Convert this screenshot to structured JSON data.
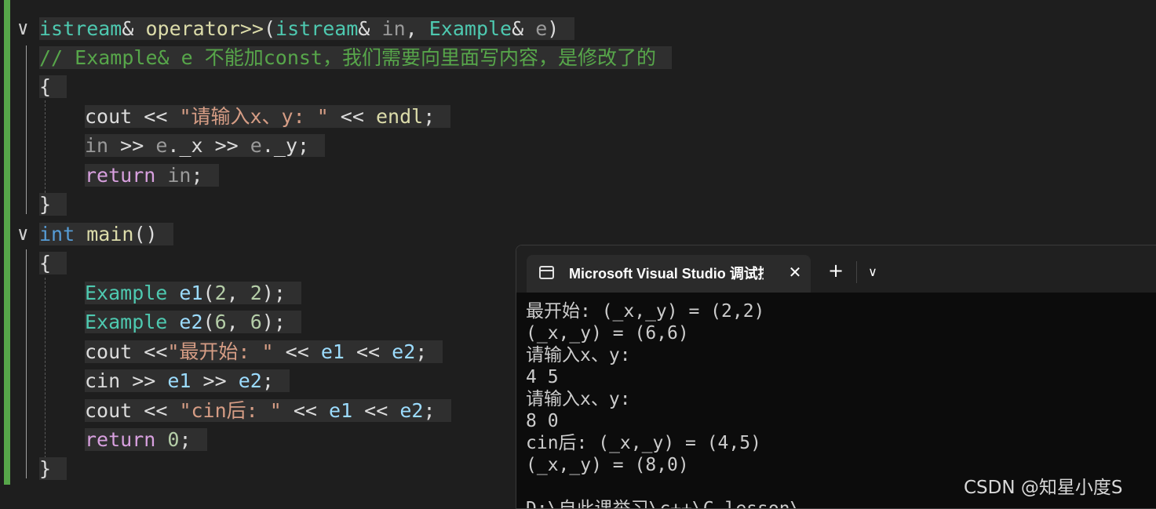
{
  "editor": {
    "lines": [
      {
        "id": "l1",
        "tokens": [
          {
            "t": "istream",
            "c": "c-type"
          },
          {
            "t": "& ",
            "c": "c-plain"
          },
          {
            "t": "operator>>",
            "c": "c-func"
          },
          {
            "t": "(",
            "c": "c-plain"
          },
          {
            "t": "istream",
            "c": "c-type"
          },
          {
            "t": "& ",
            "c": "c-plain"
          },
          {
            "t": "in",
            "c": "c-param"
          },
          {
            "t": ", ",
            "c": "c-plain"
          },
          {
            "t": "Example",
            "c": "c-type"
          },
          {
            "t": "& ",
            "c": "c-plain"
          },
          {
            "t": "e",
            "c": "c-param"
          },
          {
            "t": ")",
            "c": "c-plain"
          }
        ]
      },
      {
        "id": "l2",
        "tokens": [
          {
            "t": "// Example& e 不能加const，我们需要向里面写内容，是修改了的",
            "c": "c-comment"
          }
        ]
      },
      {
        "id": "l3",
        "tokens": [
          {
            "t": "{",
            "c": "c-plain"
          }
        ]
      },
      {
        "id": "l4",
        "tokens": [
          {
            "t": "cout",
            "c": "c-plain"
          },
          {
            "t": " << ",
            "c": "c-plain"
          },
          {
            "t": "\"请输入x、y: \"",
            "c": "c-str"
          },
          {
            "t": " << ",
            "c": "c-plain"
          },
          {
            "t": "endl",
            "c": "c-func"
          },
          {
            "t": ";",
            "c": "c-plain"
          }
        ]
      },
      {
        "id": "l5",
        "tokens": [
          {
            "t": "in",
            "c": "c-param"
          },
          {
            "t": " >> ",
            "c": "c-plain"
          },
          {
            "t": "e",
            "c": "c-param"
          },
          {
            "t": ".",
            "c": "c-plain"
          },
          {
            "t": "_x",
            "c": "c-field"
          },
          {
            "t": " >> ",
            "c": "c-plain"
          },
          {
            "t": "e",
            "c": "c-param"
          },
          {
            "t": ".",
            "c": "c-plain"
          },
          {
            "t": "_y",
            "c": "c-field"
          },
          {
            "t": ";",
            "c": "c-plain"
          }
        ]
      },
      {
        "id": "l6",
        "tokens": [
          {
            "t": "return",
            "c": "c-ctrl"
          },
          {
            "t": " ",
            "c": "c-plain"
          },
          {
            "t": "in",
            "c": "c-param"
          },
          {
            "t": ";",
            "c": "c-plain"
          }
        ]
      },
      {
        "id": "l7",
        "tokens": [
          {
            "t": "}",
            "c": "c-plain"
          }
        ]
      },
      {
        "id": "l8",
        "tokens": [
          {
            "t": "int",
            "c": "c-kw"
          },
          {
            "t": " ",
            "c": "c-plain"
          },
          {
            "t": "main",
            "c": "c-func"
          },
          {
            "t": "()",
            "c": "c-plain"
          }
        ]
      },
      {
        "id": "l9",
        "tokens": [
          {
            "t": "{",
            "c": "c-plain"
          }
        ]
      },
      {
        "id": "l10",
        "tokens": [
          {
            "t": "Example",
            "c": "c-type"
          },
          {
            "t": " ",
            "c": "c-plain"
          },
          {
            "t": "e1",
            "c": "c-var"
          },
          {
            "t": "(",
            "c": "c-plain"
          },
          {
            "t": "2",
            "c": "c-num"
          },
          {
            "t": ", ",
            "c": "c-plain"
          },
          {
            "t": "2",
            "c": "c-num"
          },
          {
            "t": ");",
            "c": "c-plain"
          }
        ]
      },
      {
        "id": "l11",
        "tokens": [
          {
            "t": "Example",
            "c": "c-type"
          },
          {
            "t": " ",
            "c": "c-plain"
          },
          {
            "t": "e2",
            "c": "c-var"
          },
          {
            "t": "(",
            "c": "c-plain"
          },
          {
            "t": "6",
            "c": "c-num"
          },
          {
            "t": ", ",
            "c": "c-plain"
          },
          {
            "t": "6",
            "c": "c-num"
          },
          {
            "t": ");",
            "c": "c-plain"
          }
        ]
      },
      {
        "id": "l12",
        "tokens": [
          {
            "t": "cout",
            "c": "c-plain"
          },
          {
            "t": " <<",
            "c": "c-plain"
          },
          {
            "t": "\"最开始: \"",
            "c": "c-str"
          },
          {
            "t": " << ",
            "c": "c-plain"
          },
          {
            "t": "e1",
            "c": "c-var"
          },
          {
            "t": " << ",
            "c": "c-plain"
          },
          {
            "t": "e2",
            "c": "c-var"
          },
          {
            "t": ";",
            "c": "c-plain"
          }
        ]
      },
      {
        "id": "l13",
        "tokens": [
          {
            "t": "cin",
            "c": "c-plain"
          },
          {
            "t": " >> ",
            "c": "c-plain"
          },
          {
            "t": "e1",
            "c": "c-var"
          },
          {
            "t": " >> ",
            "c": "c-plain"
          },
          {
            "t": "e2",
            "c": "c-var"
          },
          {
            "t": ";",
            "c": "c-plain"
          }
        ]
      },
      {
        "id": "l14",
        "tokens": [
          {
            "t": "cout",
            "c": "c-plain"
          },
          {
            "t": " << ",
            "c": "c-plain"
          },
          {
            "t": "\"cin后: \"",
            "c": "c-str"
          },
          {
            "t": " << ",
            "c": "c-plain"
          },
          {
            "t": "e1",
            "c": "c-var"
          },
          {
            "t": " << ",
            "c": "c-plain"
          },
          {
            "t": "e2",
            "c": "c-var"
          },
          {
            "t": ";",
            "c": "c-plain"
          }
        ]
      },
      {
        "id": "l15",
        "tokens": [
          {
            "t": "return",
            "c": "c-ctrl"
          },
          {
            "t": " ",
            "c": "c-plain"
          },
          {
            "t": "0",
            "c": "c-num"
          },
          {
            "t": ";",
            "c": "c-plain"
          }
        ]
      },
      {
        "id": "l16",
        "tokens": [
          {
            "t": "}",
            "c": "c-plain"
          }
        ]
      }
    ],
    "fold_marker": "∨"
  },
  "terminal": {
    "tab_title": "Microsoft Visual Studio 调试控制台",
    "close_glyph": "✕",
    "new_tab_glyph": "+",
    "dropdown_glyph": "∨",
    "output": [
      "最开始: (_x,_y) = (2,2)",
      "(_x,_y) = (6,6)",
      "请输入x、y:",
      "4 5",
      "请输入x、y:",
      "8 0",
      "cin后: (_x,_y) = (4,5)",
      "(_x,_y) = (8,0)"
    ],
    "partial_line": "D:\\自此课举习\\c++\\C_lesson\\..."
  },
  "watermark": "CSDN @知星小度S"
}
